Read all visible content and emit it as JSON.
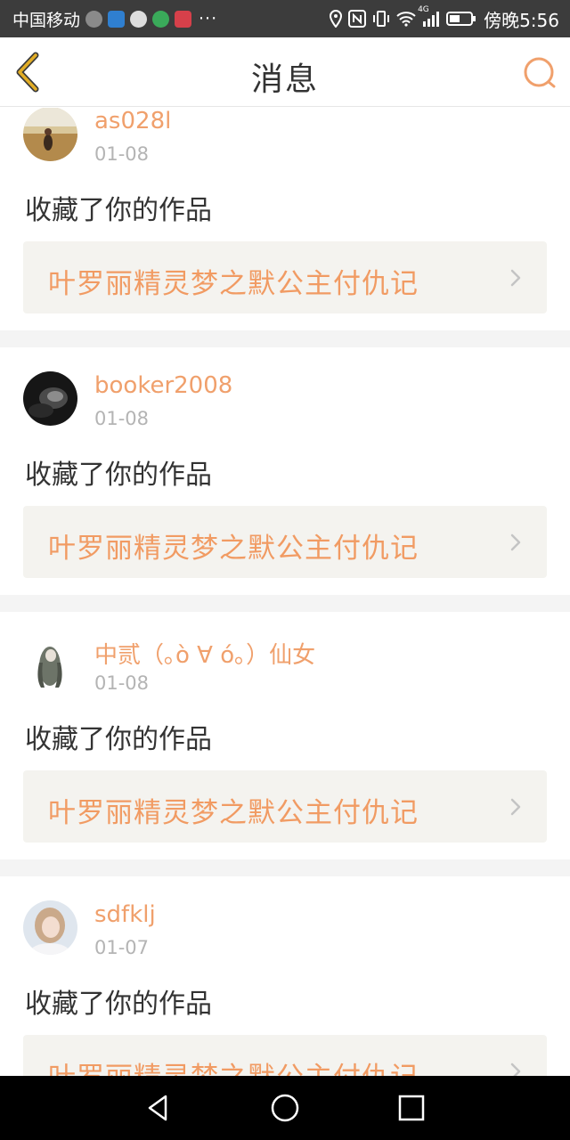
{
  "status_bar": {
    "carrier": "中国移动",
    "more": "···",
    "network": "4G",
    "time": "傍晚5:56",
    "icons": [
      "podcast-icon",
      "shield-app-icon",
      "chat-bubble-icon",
      "browser-icon",
      "book-app-icon",
      "location-icon",
      "nfc-icon",
      "vibrate-icon",
      "wifi-icon",
      "signal-icon",
      "battery-icon"
    ]
  },
  "header": {
    "title": "消息",
    "back_icon": "chevron-left-icon",
    "search_icon": "search-icon"
  },
  "colors": {
    "accent": "#f0a06c",
    "work_title": "#f19b63",
    "back_arrow": "#d9a320",
    "card_link_bg": "#f4f3ef",
    "divider": "#f4f4f4"
  },
  "messages": [
    {
      "username": "as028l",
      "date": "01-08",
      "action": "收藏了你的作品",
      "work_title": "叶罗丽精灵梦之默公主付仇记"
    },
    {
      "username": "booker2008",
      "date": "01-08",
      "action": "收藏了你的作品",
      "work_title": "叶罗丽精灵梦之默公主付仇记"
    },
    {
      "username": "中贰（｡ò ∀ ó｡）仙女",
      "date": "01-08",
      "action": "收藏了你的作品",
      "work_title": "叶罗丽精灵梦之默公主付仇记"
    },
    {
      "username": "sdfklj",
      "date": "01-07",
      "action": "收藏了你的作品",
      "work_title": "叶罗丽精灵梦之默公主付仇记"
    }
  ],
  "nav_bar": {
    "back_icon": "triangle-back-icon",
    "home_icon": "circle-home-icon",
    "recents_icon": "square-recents-icon"
  }
}
